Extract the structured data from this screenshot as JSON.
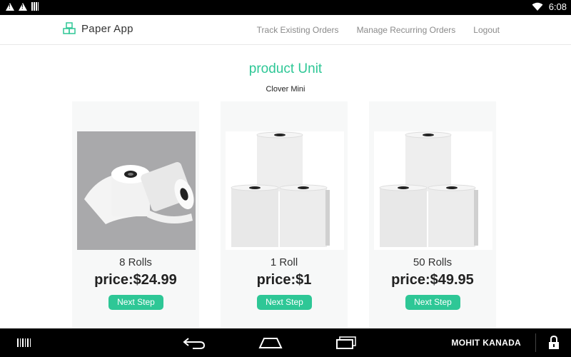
{
  "status_bar": {
    "time": "6:08",
    "icons": [
      "warning-icon",
      "warning-icon",
      "barcode-icon",
      "wifi-icon"
    ]
  },
  "header": {
    "brand": "Paper App",
    "nav": [
      {
        "label": "Track Existing Orders"
      },
      {
        "label": "Manage Recurring Orders"
      },
      {
        "label": "Logout"
      }
    ]
  },
  "page": {
    "title": "product Unit",
    "subtitle": "Clover Mini"
  },
  "products": [
    {
      "units": "8 Rolls",
      "price": "price:$24.99",
      "button": "Next Step",
      "image": "paper-rolls-photo"
    },
    {
      "units": "1 Roll",
      "price": "price:$1",
      "button": "Next Step",
      "image": "paper-roll-stack-photo"
    },
    {
      "units": "50 Rolls",
      "price": "price:$49.95",
      "button": "Next Step",
      "image": "paper-roll-stack-photo"
    }
  ],
  "nav_bar": {
    "user": "MOHIT KANADA",
    "icons": [
      "barcode-icon",
      "back-icon",
      "home-icon",
      "recent-apps-icon",
      "lock-icon"
    ]
  },
  "colors": {
    "accent": "#2ec796",
    "status_bar": "#000000",
    "card_bg": "#f7f8f8"
  }
}
